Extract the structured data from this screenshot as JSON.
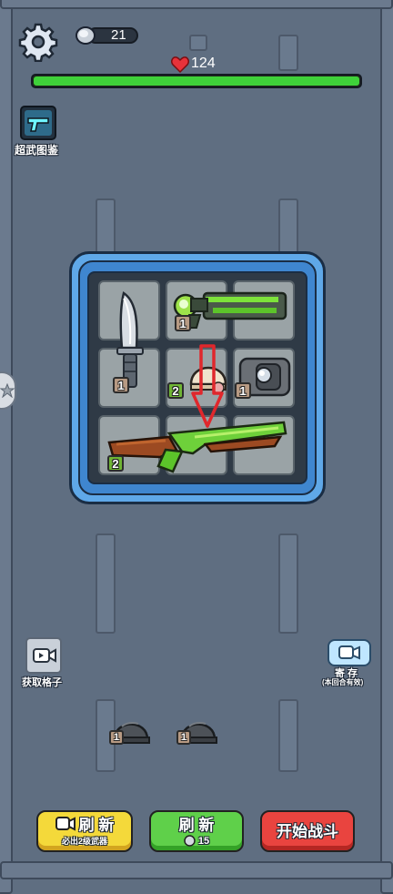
{
  "hud": {
    "coin_count": "21",
    "health_value": "124",
    "health_fill": 1.0
  },
  "left_panel": {
    "weapon_guide_label": "超武图鉴",
    "get_slot_label": "获取格子"
  },
  "right_panel": {
    "store_label": "寄 存",
    "store_sublabel": "(本回合有效)"
  },
  "grid": {
    "knife_level": "1",
    "rifle_level": "1",
    "helmet_level": "2",
    "shield_level": "1",
    "shotgun_level": "2"
  },
  "bench": {
    "helmet_a_level": "1",
    "helmet_b_level": "1"
  },
  "buttons": {
    "refresh_ad_label": "刷 新",
    "refresh_ad_sub": "必出2级武器",
    "refresh_coin_label": "刷 新",
    "refresh_coin_cost": "15",
    "start_battle_label": "开始战斗"
  },
  "icons": [
    "gear-icon",
    "coin-icon",
    "heart-icon",
    "pistol-icon",
    "video-icon",
    "knife-icon",
    "rifle-icon",
    "helmet-icon",
    "shield-icon",
    "shotgun-icon",
    "arrow-down-icon",
    "star-icon"
  ]
}
